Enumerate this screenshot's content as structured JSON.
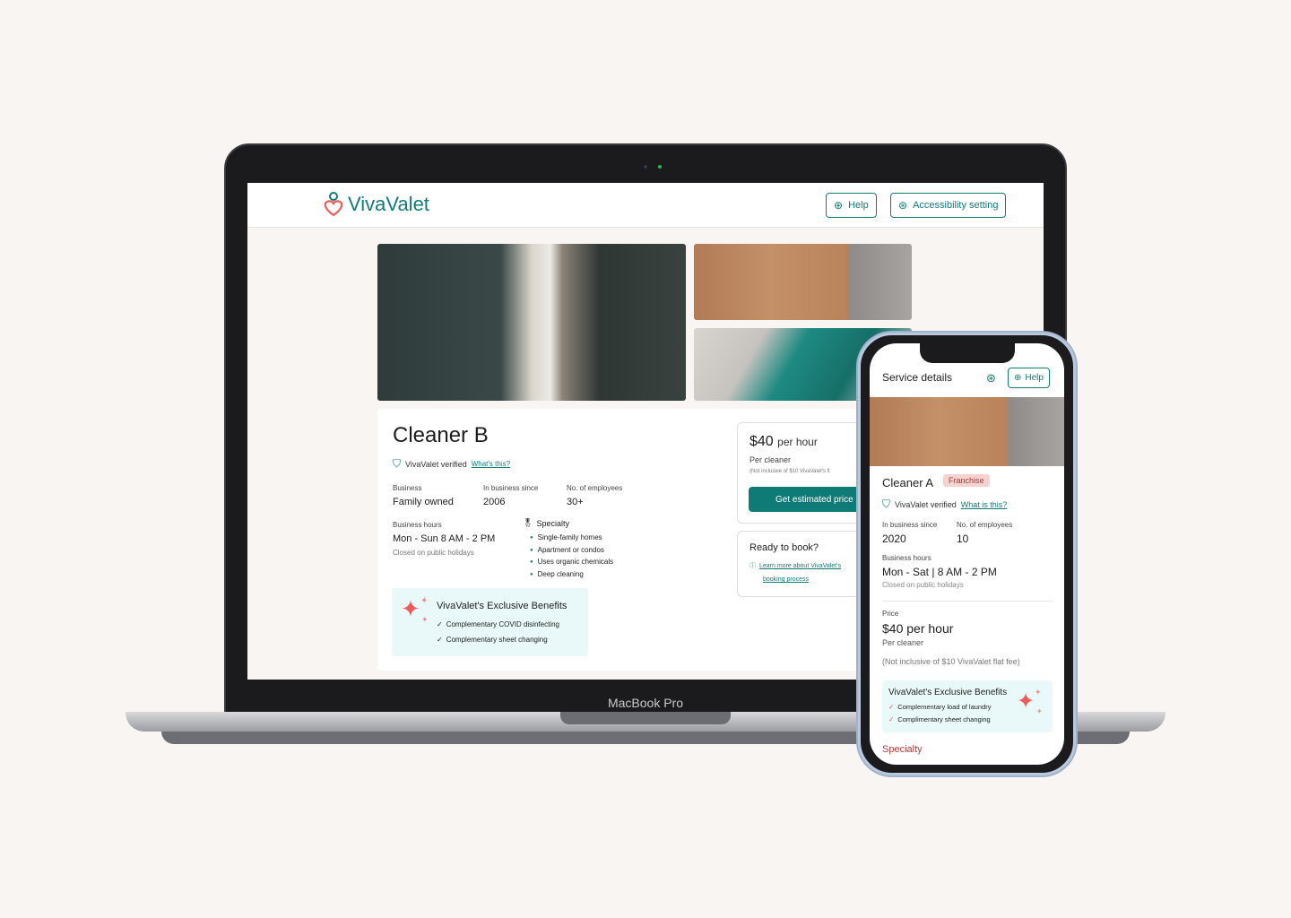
{
  "laptop": {
    "model_label": "MacBook Pro"
  },
  "app": {
    "brand": "VivaValet",
    "header": {
      "help_label": "Help",
      "accessibility_label": "Accessibility setting"
    },
    "cleaner": {
      "name": "Cleaner B",
      "verified_text": "VivaValet verified",
      "verified_link": "What's this?",
      "business_label": "Business",
      "business_value": "Family owned",
      "since_label": "In business since",
      "since_value": "2006",
      "employees_label": "No. of employees",
      "employees_value": "30+",
      "hours_label": "Business hours",
      "hours_value": "Mon - Sun  8 AM - 2 PM",
      "hours_note": "Closed on public holidays",
      "specialty_label": "Specialty",
      "specialties": [
        "Single-family homes",
        "Apartment or condos",
        "Uses organic chemicals",
        "Deep cleaning"
      ],
      "benefits_title": "VivaValet's Exclusive Benefits",
      "benefits": [
        "Complementary COVID disinfecting",
        "Complementary sheet changing"
      ]
    },
    "price_card": {
      "price": "$40",
      "unit": "per hour",
      "sub": "Per cleaner",
      "note": "(Not inclusive of $10 VivaValet's fl",
      "button": "Get estimated price"
    },
    "ready_card": {
      "title": "Ready to book?",
      "link_line1": "Learn more about VivaValet's",
      "link_line2": "booking process"
    }
  },
  "phone": {
    "title": "Service details",
    "help_label": "Help",
    "name": "Cleaner A",
    "badge": "Franchise",
    "verified_text": "VivaValet verified",
    "verified_link": "What is this?",
    "since_label": "In business since",
    "since_value": "2020",
    "employees_label": "No. of employees",
    "employees_value": "10",
    "hours_label": "Business hours",
    "hours_value": "Mon - Sat | 8 AM - 2 PM",
    "hours_note": "Closed on public holidays",
    "price_label": "Price",
    "price_value": "$40 per hour",
    "price_sub": "Per cleaner",
    "price_note": "(Not inclusive of $10 VivaValet flat fee)",
    "benefits_title": "VivaValet's Exclusive Benefits",
    "benefits": [
      "Complementary load of laundry",
      "Complimentary sheet changing"
    ],
    "specialty_label": "Specialty"
  },
  "colors": {
    "brand_teal": "#107c78",
    "accent_coral": "#f05a5a",
    "benefit_bg": "#e9f8f8"
  }
}
